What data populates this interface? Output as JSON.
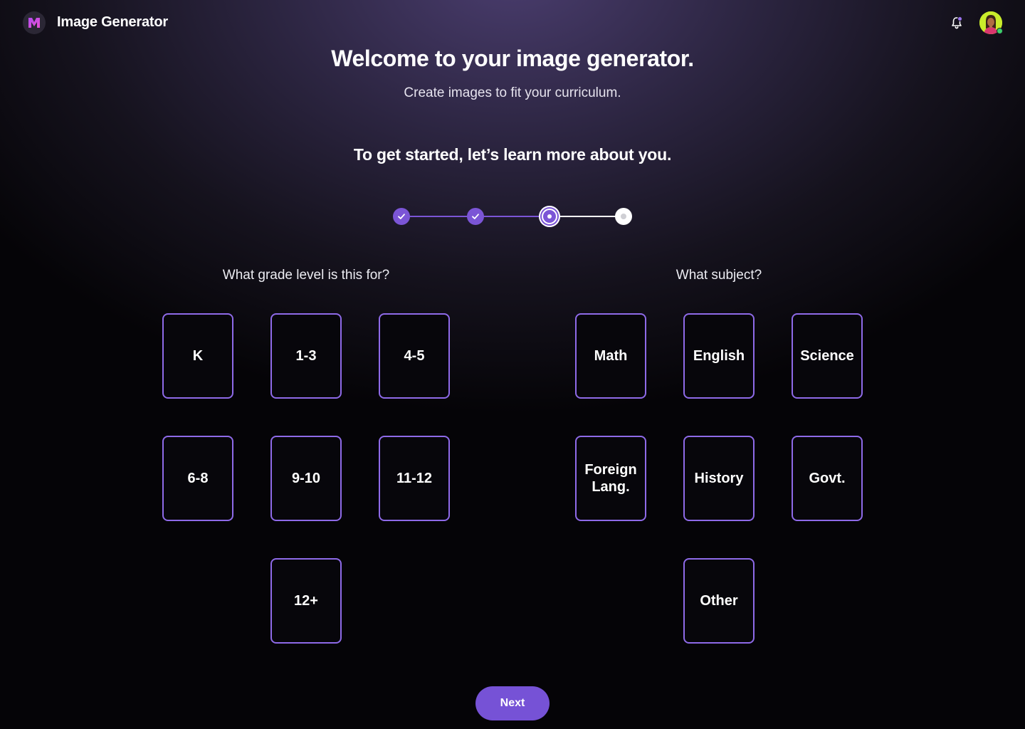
{
  "header": {
    "app_title": "Image Generator",
    "logo_icon": "m-logo-icon",
    "notification_icon": "bell-icon",
    "avatar": "user-avatar"
  },
  "intro": {
    "title": "Welcome to your image generator.",
    "subtitle": "Create images to fit your curriculum.",
    "prompt": "To get started, let’s learn more about you."
  },
  "stepper": {
    "total_steps": 4,
    "current_step": 3,
    "steps": [
      {
        "state": "completed",
        "icon": "check-icon"
      },
      {
        "state": "completed",
        "icon": "check-icon"
      },
      {
        "state": "current",
        "icon": "dot-icon"
      },
      {
        "state": "upcoming",
        "icon": "dot-icon"
      }
    ]
  },
  "grade": {
    "question": "What grade level is this for?",
    "options": [
      "K",
      "1-3",
      "4-5",
      "6-8",
      "9-10",
      "11-12",
      "12+"
    ]
  },
  "subject": {
    "question": "What subject?",
    "options": [
      "Math",
      "English",
      "Science",
      "Foreign Lang.",
      "History",
      "Govt.",
      "Other"
    ]
  },
  "actions": {
    "next_label": "Next"
  },
  "colors": {
    "accent": "#7B55D6",
    "card_border": "#8E6AE8",
    "online": "#3CCF6A"
  }
}
